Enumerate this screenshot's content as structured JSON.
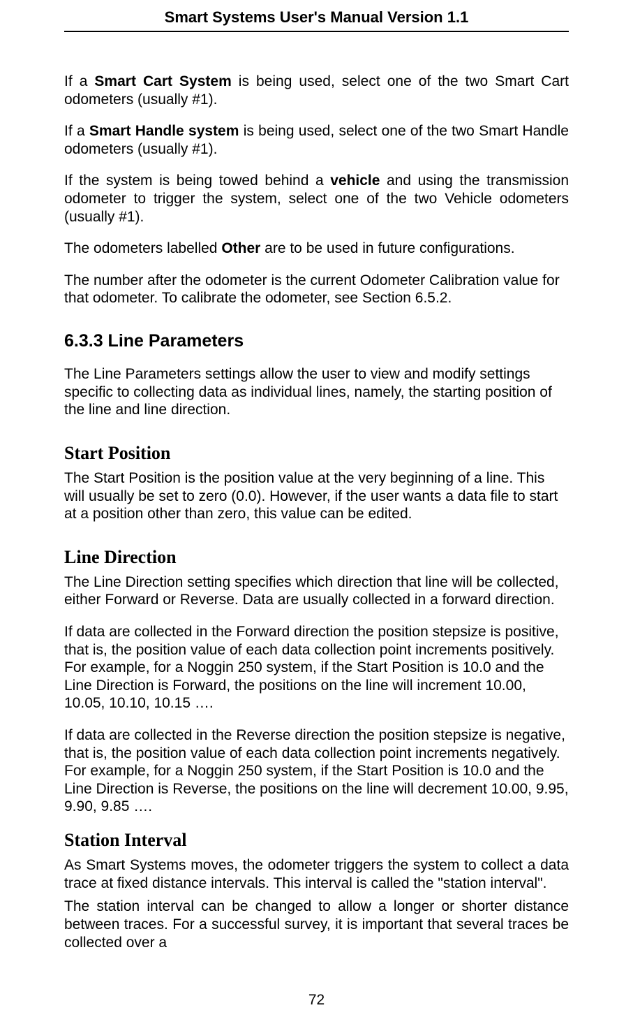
{
  "header": {
    "title": "Smart Systems User's Manual Version 1.1"
  },
  "body": {
    "p1a": "If a ",
    "p1b": "Smart Cart System",
    "p1c": " is being used, select one of the two Smart Cart odometers (usually #1).",
    "p2a": "If a ",
    "p2b": "Smart Handle system",
    "p2c": " is being used, select one of the two Smart Handle odometers (usually #1).",
    "p3a": "If the system is being towed behind a ",
    "p3b": "vehicle",
    "p3c": " and using the transmission odometer to trigger the system, select one of the two Vehicle odometers (usually #1).",
    "p4a": "The odometers labelled ",
    "p4b": "Other",
    "p4c": " are to be used in future configurations.",
    "p5": "The number after the odometer is the current Odometer Calibration value for that odometer.  To calibrate the odometer, see Section 6.5.2.",
    "h_633": "6.3.3 Line Parameters",
    "p6": "The Line Parameters settings allow the user to view and modify settings specific to collecting data as individual lines, namely, the starting position of the line and line direction.",
    "h_start": "Start Position",
    "p7": "The Start Position is the position value at the very beginning of a line.  This will usually be set to zero (0.0).  However, if the user wants a data file to start at a position other than zero, this value can be edited.",
    "h_linedir": "Line Direction",
    "p8": "The Line Direction setting specifies which direction that line will be collected, either Forward or Reverse.  Data are usually collected in a forward direction.",
    "p9": "If data are collected in the Forward direction the position stepsize is positive, that is, the position value of each data collection point increments positively.  For example, for a Noggin 250 system, if the Start Position is 10.0 and the Line Direction is Forward, the positions on the line will increment 10.00, 10.05, 10.10, 10.15 ….",
    "p10": "If data are collected in the Reverse direction the position stepsize is negative, that is, the position value of each data collection point increments negatively.  For example, for a Noggin 250 system, if the Start Position is 10.0 and the Line Direction is Reverse, the positions on the line will decrement 10.00, 9.95, 9.90, 9.85 ….",
    "h_station": "Station Interval",
    "p11": "As Smart Systems moves, the odometer triggers the system to collect a data trace at fixed distance intervals. This interval is called the \"station interval\".",
    "p12": "The station interval can be changed to allow a longer or shorter distance between traces.  For a successful survey, it is important that several traces be collected over a"
  },
  "footer": {
    "pagenum": "72"
  }
}
